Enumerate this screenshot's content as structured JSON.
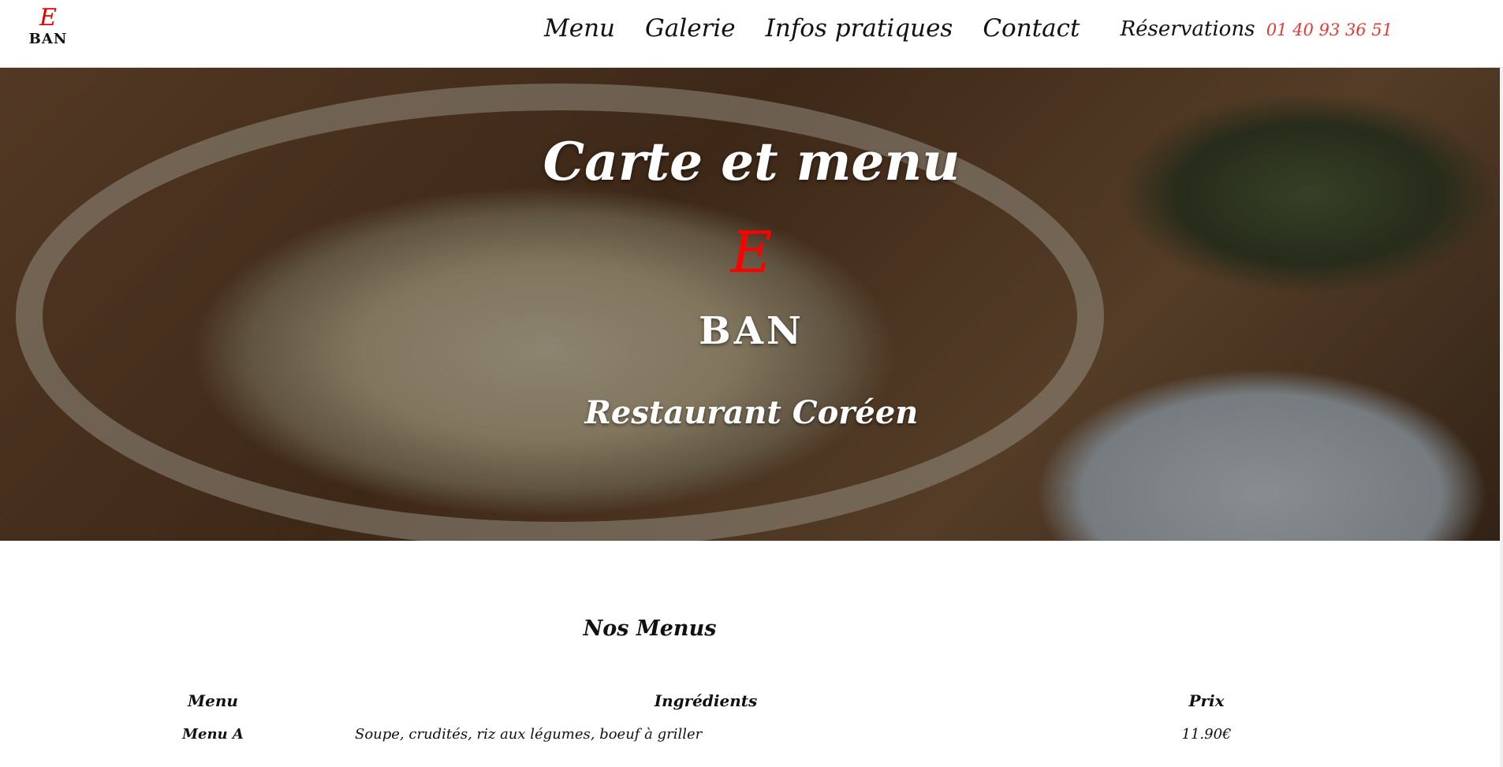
{
  "header": {
    "logo_letter": "E",
    "logo_name": "BAN",
    "nav": [
      "Menu",
      "Galerie",
      "Infos pratiques",
      "Contact"
    ],
    "reservation_label": "Réservations",
    "reservation_phone": "01 40 93 36 51"
  },
  "hero": {
    "title": "Carte et menu",
    "logo_letter": "E",
    "logo_name": "BAN",
    "subtitle": "Restaurant Coréen"
  },
  "menus": {
    "title": "Nos Menus",
    "columns": [
      "Menu",
      "Ingrédients",
      "Prix"
    ],
    "rows": [
      {
        "name": "Menu A",
        "ingredients": "Soupe, crudités, riz aux légumes, boeuf à griller",
        "price": "11.90€"
      }
    ]
  },
  "colors": {
    "accent_red": "#e60000",
    "phone_red": "#e53935"
  }
}
